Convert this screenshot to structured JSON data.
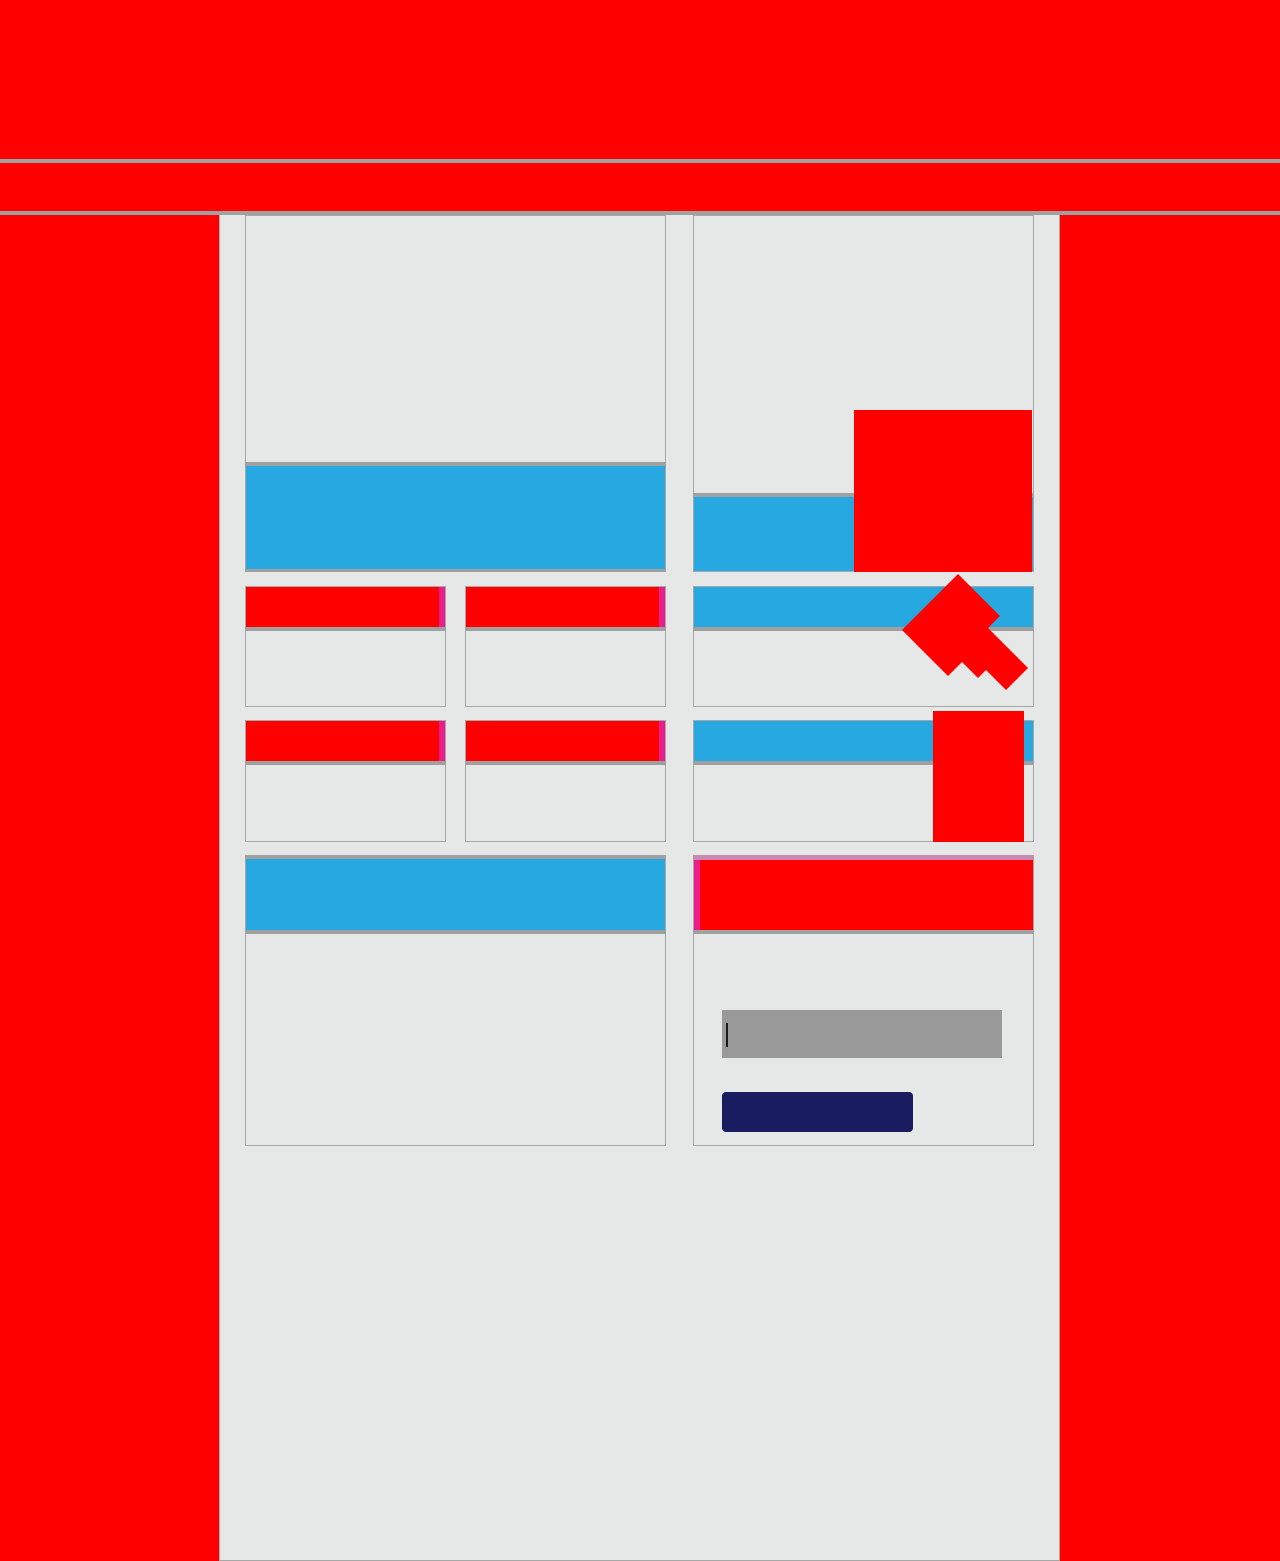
{
  "header": {
    "title": ""
  },
  "nav": {
    "label": ""
  },
  "featured": {
    "left": {
      "caption": ""
    },
    "right": {
      "caption": ""
    }
  },
  "small_cards": [
    {
      "title": ""
    },
    {
      "title": ""
    },
    {
      "title": ""
    },
    {
      "title": ""
    }
  ],
  "side_cards": [
    {
      "title": ""
    },
    {
      "title": ""
    }
  ],
  "bottom_left": {
    "title": "",
    "body": ""
  },
  "signup": {
    "title": "",
    "input_value": "",
    "input_placeholder": "",
    "button_label": ""
  },
  "colors": {
    "page_background": "#ff0000",
    "content_background": "#e6e7e7",
    "header_blue": "#27a8e0",
    "header_red": "#ff0000",
    "accent_magenta": "#e91e8c",
    "divider_gray": "#a0a0a0",
    "input_gray": "#999999",
    "button_navy": "#1a1c62"
  }
}
